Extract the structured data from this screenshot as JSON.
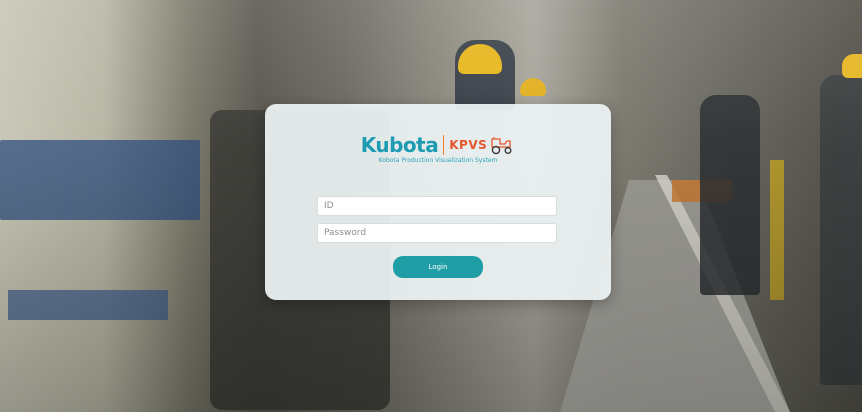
{
  "login": {
    "brand_name": "Kubota",
    "product_abbr": "KPVS",
    "product_logo_icon": "tractor-icon",
    "subtitle": "Kobota Production Visualization System",
    "id_placeholder": "ID",
    "id_value": "",
    "password_placeholder": "Password",
    "password_value": "",
    "login_label": "Login"
  },
  "colors": {
    "brand_teal": "#1c9bb2",
    "kpvs_red": "#e4572e",
    "button": "#1f9ea6",
    "card_bg": "#ecf2f2"
  }
}
